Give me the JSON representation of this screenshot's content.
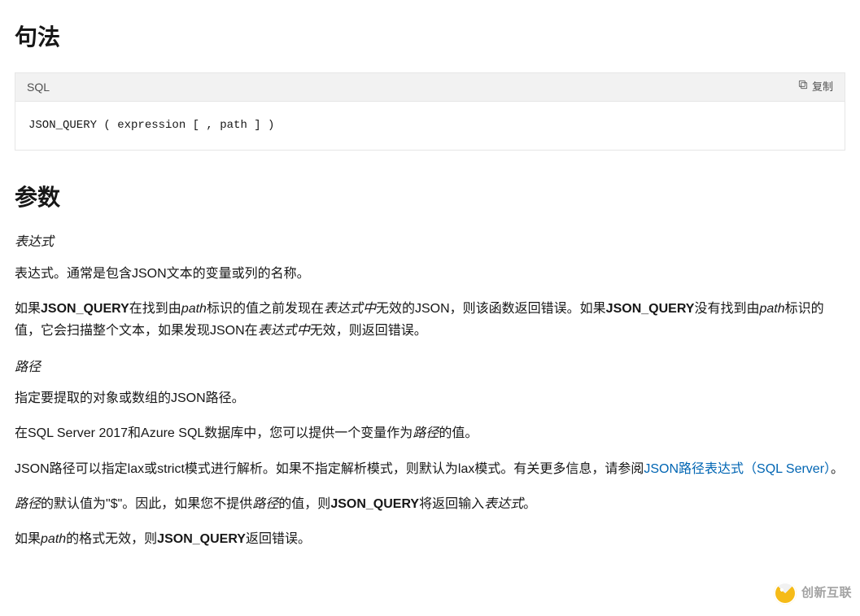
{
  "syntax": {
    "title": "句法",
    "lang_label": "SQL",
    "copy_label": "复制",
    "code": "JSON_QUERY ( expression [ , path ] )  "
  },
  "params": {
    "title": "参数",
    "term_expression": "表达式",
    "desc_expression": "表达式。通常是包含JSON文本的变量或列的名称。",
    "p1": {
      "s1": "如果",
      "jq1": "JSON_QUERY",
      "s2": "在找到由",
      "path1": "path",
      "s3": "标识的值之前发现在",
      "expr1": "表达式中",
      "s4": "无效的JSON，则该函数返回错误。如果",
      "jq2": "JSON_QUERY",
      "s5": "没有找到由",
      "path2": "path",
      "s6": "标识的值，它会扫描整个文本，如果发现JSON在",
      "expr2": "表达式中",
      "s7": "无效，则返回错误。"
    },
    "term_path": "路径",
    "desc_path": "指定要提取的对象或数组的JSON路径。",
    "p2": {
      "s1": "在SQL Server 2017和Azure SQL数据库中，您可以提供一个变量作为",
      "path": "路径",
      "s2": "的值。"
    },
    "p3": {
      "s1": "JSON路径可以指定lax或strict模式进行解析。如果不指定解析模式，则默认为lax模式。有关更多信息，请参阅",
      "link": "JSON路径表达式（SQL Server）",
      "s2": "。"
    },
    "p4": {
      "path1": "路径",
      "s1": "的默认值为\"$\"。因此，如果您不提供",
      "path2": "路径",
      "s2": "的值，则",
      "jq": "JSON_QUERY",
      "s3": "将返回输入",
      "expr": "表达式",
      "s4": "。"
    },
    "p5": {
      "s1": "如果",
      "path": "path",
      "s2": "的格式无效，则",
      "jq": "JSON_QUERY",
      "s3": "返回错误。"
    }
  },
  "watermark": "创新互联"
}
